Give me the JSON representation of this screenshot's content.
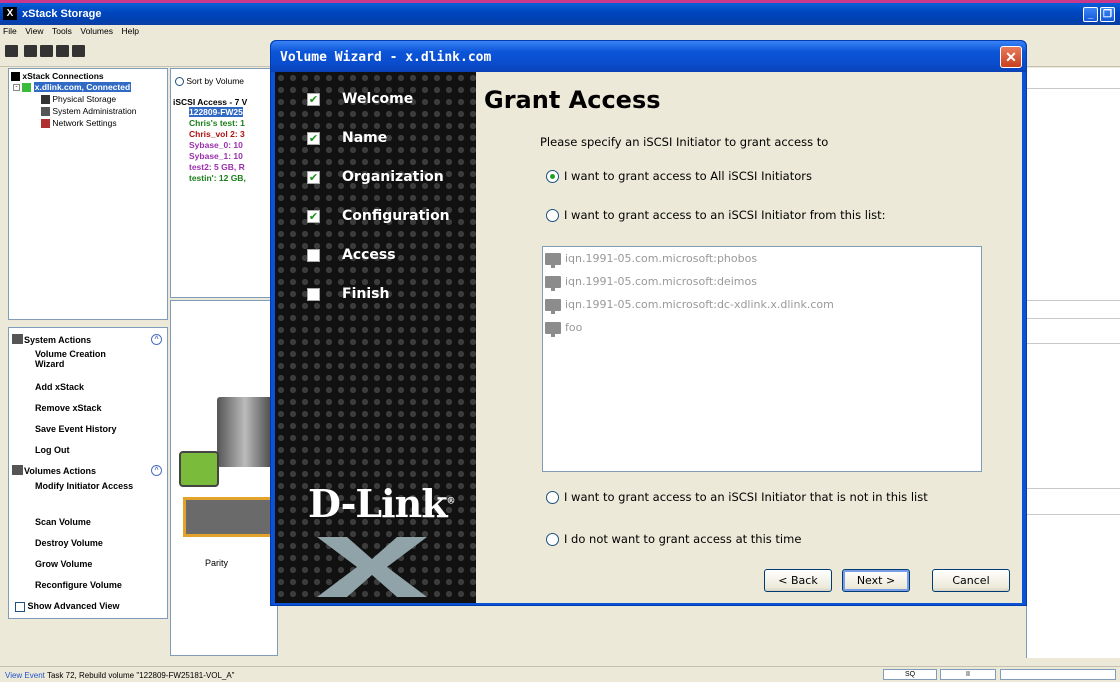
{
  "app": {
    "title": "xStack Storage",
    "logo_glyph": "X",
    "menu": [
      "File",
      "View",
      "Tools",
      "Volumes",
      "Help"
    ]
  },
  "connections": {
    "header": "xStack Connections",
    "selected": "x.dlink.com, Connected",
    "items": [
      "Physical Storage",
      "System Administration",
      "Network Settings"
    ]
  },
  "volume_view": {
    "sort_label": "Sort by Volume",
    "group_label": "iSCSI Access - 7 V",
    "volumes": [
      {
        "label": "122809-FW25",
        "color": "#ffffff"
      },
      {
        "label": "Chris's test: 1",
        "color": "#1a7f1a"
      },
      {
        "label": "Chris_vol 2: 3",
        "color": "#b01010"
      },
      {
        "label": "Sybase_0: 10",
        "color": "#9b2fae"
      },
      {
        "label": "Sybase_1: 10",
        "color": "#9b2fae"
      },
      {
        "label": "test2: 5 GB, R",
        "color": "#9b2fae"
      },
      {
        "label": "testin': 12 GB,",
        "color": "#1a7f1a"
      }
    ],
    "parity_label": "Parity"
  },
  "system_actions": {
    "header": "System Actions",
    "items": [
      "Volume Creation Wizard",
      "Add xStack",
      "Remove xStack",
      "Save Event History",
      "Log Out"
    ]
  },
  "volumes_actions": {
    "header": "Volumes Actions",
    "items": [
      "Modify Initiator Access",
      "Scan Volume",
      "Destroy Volume",
      "Grow Volume",
      "Reconfigure Volume"
    ],
    "advanced_label": "Show Advanced View"
  },
  "status": {
    "link": "View Event",
    "message": "Task 72, Rebuild volume \"122809-FW25181-VOL_A\"",
    "indicators": [
      "SQ",
      "II"
    ]
  },
  "dialog": {
    "title": "Volume Wizard - x.dlink.com",
    "steps": [
      {
        "label": "Welcome",
        "checked": true
      },
      {
        "label": "Name",
        "checked": true
      },
      {
        "label": "Organization",
        "checked": true
      },
      {
        "label": "Configuration",
        "checked": true
      },
      {
        "label": "Access",
        "checked": false
      },
      {
        "label": "Finish",
        "checked": false
      }
    ],
    "brand": "D-Link",
    "brand_mark": "®",
    "heading": "Grant Access",
    "instruction": "Please specify an iSCSI Initiator to grant access to",
    "options": [
      "I want to grant access to All iSCSI Initiators",
      "I want to grant access to an iSCSI Initiator from this list:",
      "I want to grant access to an iSCSI Initiator that is not in this list",
      "I do not want to grant access at this time"
    ],
    "selected_option": 0,
    "initiators": [
      "iqn.1991-05.com.microsoft:phobos",
      "iqn.1991-05.com.microsoft:deimos",
      "iqn.1991-05.com.microsoft:dc-xdlink.x.dlink.com",
      "foo"
    ],
    "buttons": {
      "back": "< Back",
      "next": "Next >",
      "cancel": "Cancel"
    }
  }
}
